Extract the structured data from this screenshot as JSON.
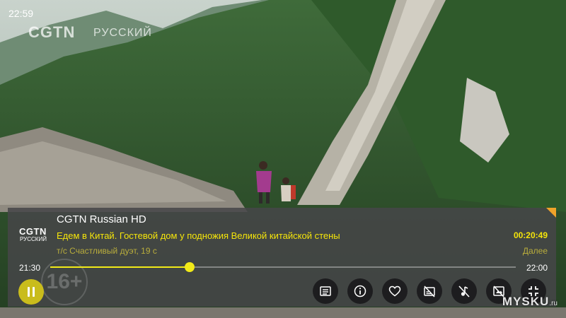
{
  "status": {
    "clock": "22:59"
  },
  "watermark": {
    "logo": "CGTN",
    "lang": "РУССКИЙ"
  },
  "player": {
    "channel_logo": "CGTN",
    "channel_logo_sub": "РУССКИЙ",
    "channel_name": "CGTN Russian HD",
    "current_program": "Едем в Китай. Гостевой дом у подножия Великой китайской стены",
    "current_time": "00:20:49",
    "next_program": "т/с Счастливый дуэт, 19 с",
    "next_label": "Далее",
    "start_time": "21:30",
    "end_time": "22:00",
    "progress": 0.3,
    "age_rating": "16+",
    "accent": "#f2ea18"
  },
  "controls": [
    {
      "name": "list-icon"
    },
    {
      "name": "info-icon"
    },
    {
      "name": "heart-icon"
    },
    {
      "name": "subtitles-off-icon"
    },
    {
      "name": "audio-off-icon"
    },
    {
      "name": "picture-off-icon"
    },
    {
      "name": "fullscreen-exit-icon"
    }
  ],
  "site_watermark": {
    "main": "MYSKU",
    "suffix": ".ru"
  }
}
